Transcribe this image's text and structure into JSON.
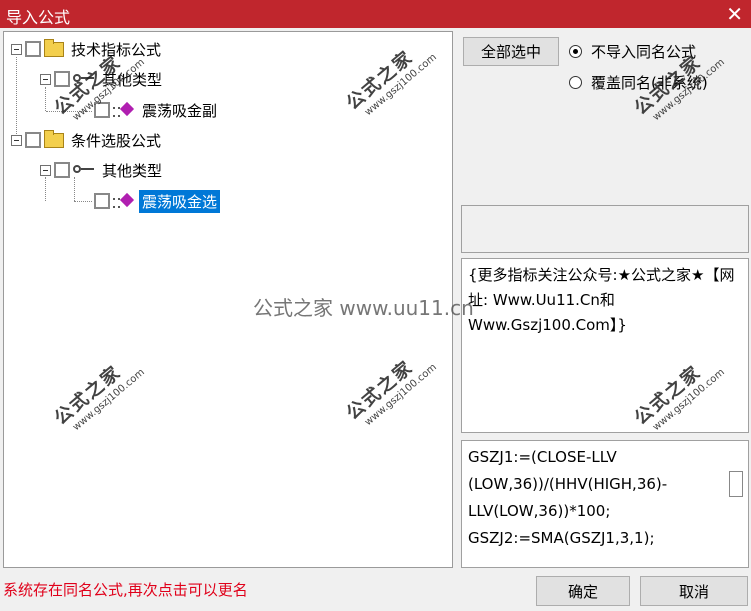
{
  "window": {
    "title": "导入公式",
    "close_glyph": "✕"
  },
  "tree": {
    "nodes": [
      {
        "label": "技术指标公式"
      },
      {
        "label": "其他类型"
      },
      {
        "label": "震荡吸金副"
      },
      {
        "label": "条件选股公式"
      },
      {
        "label": "其他类型"
      },
      {
        "label": "震荡吸金选",
        "selected": true
      }
    ]
  },
  "options": {
    "select_all_label": "全部选中",
    "radio_no_import": "不导入同名公式",
    "radio_overwrite": "覆盖同名(非系统)",
    "selected": "no_import"
  },
  "description": "{更多指标关注公众号:★公式之家★【网址: Www.Uu11.Cn和Www.Gszj100.Com】}",
  "code": "GSZJ1:=(CLOSE-LLV\n(LOW,36))/(HHV(HIGH,36)-\nLLV(LOW,36))*100;\nGSZJ2:=SMA(GSZJ1,3,1);",
  "status_text": "系统存在同名公式,再次点击可以更名",
  "buttons": {
    "ok": "确定",
    "cancel": "取消"
  },
  "watermark": {
    "text": "公式之家",
    "url": "www.gszj100.com",
    "center": "公式之家 www.uu11.cn"
  },
  "colors": {
    "titlebar": "#c0262d",
    "selection": "#0078d7",
    "status": "#e0001a"
  }
}
